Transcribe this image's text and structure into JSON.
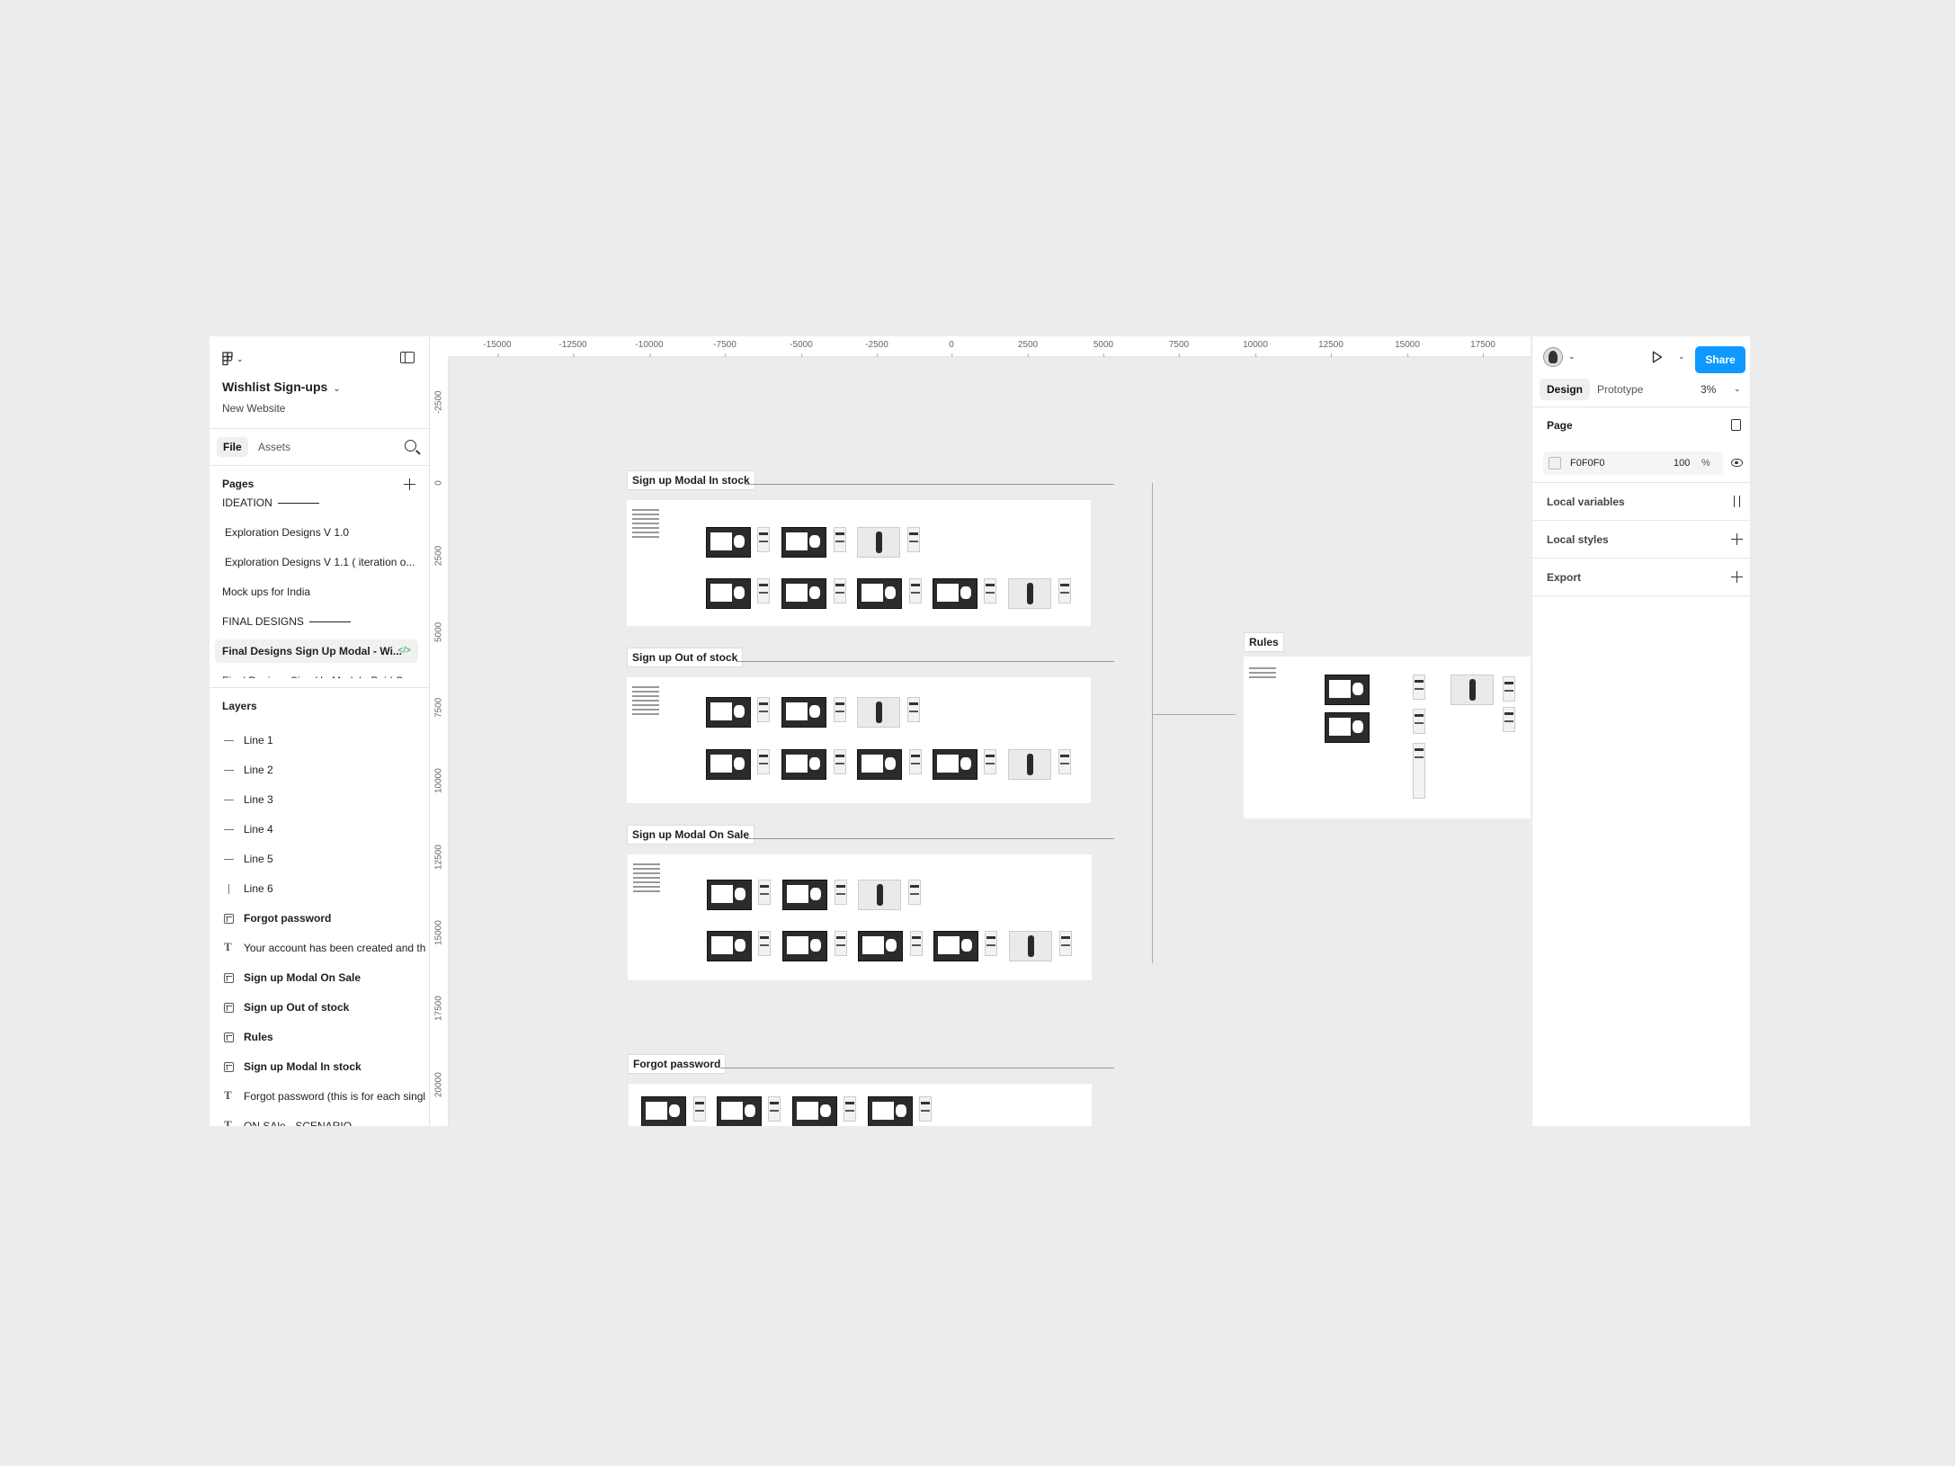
{
  "left_panel": {
    "file_title": "Wishlist Sign-ups",
    "file_subtitle": "New Website",
    "tabs": [
      "File",
      "Assets"
    ],
    "pages_header": "Pages",
    "pages": [
      {
        "label": "IDEATION"
      },
      {
        "label": "Exploration Designs V 1.0"
      },
      {
        "label": "Exploration Designs V 1.1 ( iteration o..."
      },
      {
        "label": "Mock ups for India"
      },
      {
        "label": "FINAL DESIGNS"
      },
      {
        "label": "Final Designs Sign Up Modal - Wi...",
        "selected": true,
        "icon": "code-icon"
      },
      {
        "label": "Final Designs Sign Up Modal - Paid C..."
      }
    ],
    "layers_header": "Layers",
    "layers": [
      {
        "label": "Line 1",
        "icon": "line-icon"
      },
      {
        "label": "Line 2",
        "icon": "line-icon"
      },
      {
        "label": "Line 3",
        "icon": "line-icon"
      },
      {
        "label": "Line 4",
        "icon": "line-icon"
      },
      {
        "label": "Line  5",
        "icon": "line-icon"
      },
      {
        "label": "Line 6",
        "icon": "vertical-line-icon"
      },
      {
        "label": "Forgot password",
        "icon": "frame-icon"
      },
      {
        "label": "Your account has been created and th",
        "icon": "text-icon"
      },
      {
        "label": "Sign up Modal On Sale",
        "icon": "frame-icon"
      },
      {
        "label": "Sign up Out of stock",
        "icon": "frame-icon"
      },
      {
        "label": "Rules",
        "icon": "frame-icon"
      },
      {
        "label": "Sign up Modal In stock",
        "icon": "frame-icon"
      },
      {
        "label": "Forgot password (this is for each singl",
        "icon": "text-icon"
      },
      {
        "label": "ON SAle - SCENARIO",
        "icon": "text-icon"
      }
    ]
  },
  "rulers": {
    "top": [
      "-15000",
      "-12500",
      "-10000",
      "-7500",
      "-5000",
      "-2500",
      "0",
      "2500",
      "5000",
      "7500",
      "10000",
      "12500",
      "15000",
      "17500"
    ],
    "left": [
      "-2500",
      "0",
      "2500",
      "5000",
      "7500",
      "10000",
      "12500",
      "15000",
      "17500",
      "20000"
    ]
  },
  "canvas": {
    "frames": [
      {
        "label": "Sign up Modal In stock"
      },
      {
        "label": "Sign up Out of stock"
      },
      {
        "label": "Sign up Modal On Sale"
      },
      {
        "label": "Forgot password"
      },
      {
        "label": "Rules"
      }
    ]
  },
  "right_panel": {
    "share_label": "Share",
    "tabs": [
      "Design",
      "Prototype"
    ],
    "zoom": "3%",
    "page_section": "Page",
    "page_color_hex": "F0F0F0",
    "page_color_opacity": "100",
    "percent_sign": "%",
    "local_variables": "Local variables",
    "local_styles": "Local styles",
    "export": "Export"
  },
  "colors": {
    "accent": "#0d99ff",
    "canvas_bg": "#f0f0f0",
    "code_badge": "#1aa34a"
  }
}
